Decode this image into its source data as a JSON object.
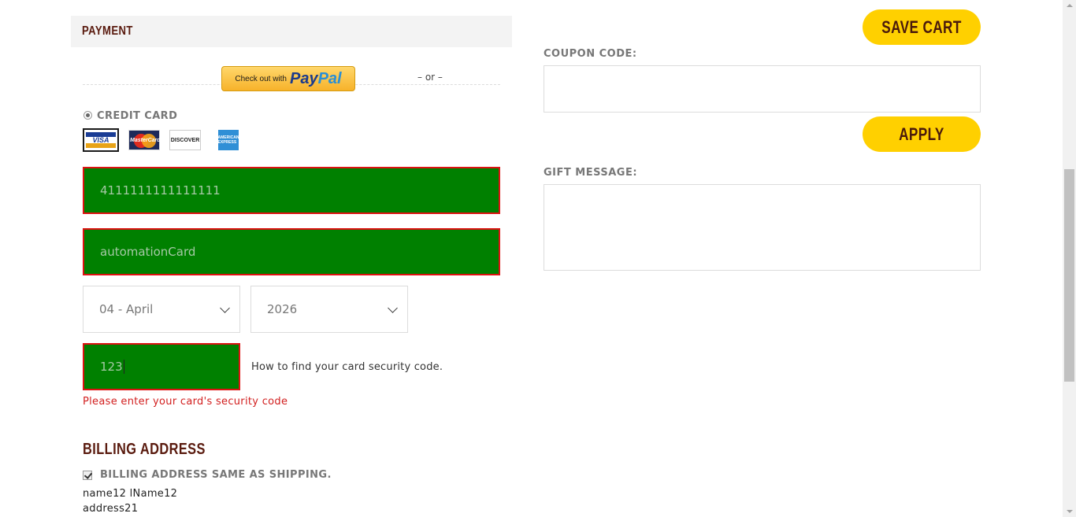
{
  "payment": {
    "title": "PAYMENT",
    "paypal_small": "Check out with",
    "paypal_brand_1": "Pay",
    "paypal_brand_2": "Pal",
    "or_text": "– or –",
    "credit_card_label": "CREDIT CARD",
    "card_logos": [
      "VISA",
      "MasterCard",
      "DISCOVER",
      "AMERICAN EXPRESS"
    ],
    "card_number_value": "4111111111111111",
    "card_name_value": "automationCard",
    "expiry_month_selected": "04 - April",
    "expiry_year_selected": "2026",
    "security_code_value": "123",
    "security_help_link": "How to find your card security code.",
    "security_error": "Please enter your card's security code"
  },
  "billing": {
    "title": "BILLING ADDRESS",
    "same_as_shipping_label": "BILLING ADDRESS SAME AS SHIPPING.",
    "name_line": "name12 lName12",
    "address_line": "address21"
  },
  "cart": {
    "save_cart_label": "SAVE CART",
    "coupon_label": "COUPON CODE:",
    "apply_label": "APPLY",
    "gift_message_label": "GIFT MESSAGE:"
  },
  "colors": {
    "accent_yellow": "#ffd000",
    "brand_brown": "#5a1b0f",
    "error_red": "#d21f1f",
    "field_fill_green": "#008000"
  },
  "icons": {
    "radio": "radio-selected-icon",
    "checkbox": "checkbox-checked-icon",
    "dropdown": "chevron-down-icon"
  }
}
